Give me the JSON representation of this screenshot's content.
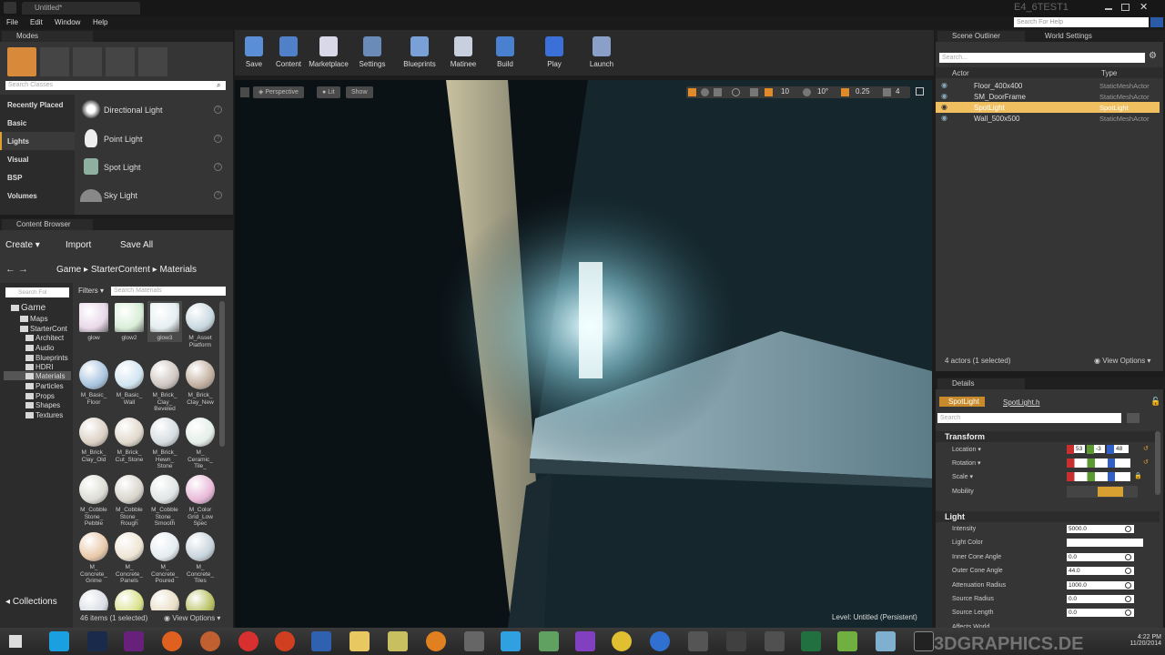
{
  "window": {
    "tab_title": "Untitled*",
    "project_name": "E4_6TEST1",
    "search_help_placeholder": "Search For Help"
  },
  "menu": [
    "File",
    "Edit",
    "Window",
    "Help"
  ],
  "modes": {
    "tab": "Modes",
    "search_placeholder": "Search Classes",
    "categories": [
      "Recently Placed",
      "Basic",
      "Lights",
      "Visual",
      "BSP",
      "Volumes"
    ],
    "items": [
      {
        "label": "Directional Light",
        "icon": "sun-icon"
      },
      {
        "label": "Point Light",
        "icon": "bulb-icon"
      },
      {
        "label": "Spot Light",
        "icon": "spotlight-icon"
      },
      {
        "label": "Sky Light",
        "icon": "dome-icon"
      }
    ]
  },
  "content_browser": {
    "tab": "Content Browser",
    "create": "Create",
    "import": "Import",
    "save_all": "Save All",
    "breadcrumb": [
      "Game",
      "StarterContent",
      "Materials"
    ],
    "folder_search_placeholder": "Search Fol",
    "filters": "Filters",
    "search_placeholder": "Search Materials",
    "tree": [
      {
        "label": "Game",
        "level": 0
      },
      {
        "label": "Maps",
        "level": 1
      },
      {
        "label": "StarterCont",
        "level": 1
      },
      {
        "label": "Architect",
        "level": 2
      },
      {
        "label": "Audio",
        "level": 2
      },
      {
        "label": "Blueprints",
        "level": 2
      },
      {
        "label": "HDRI",
        "level": 2
      },
      {
        "label": "Materials",
        "level": 2,
        "selected": true
      },
      {
        "label": "Particles",
        "level": 2
      },
      {
        "label": "Props",
        "level": 2
      },
      {
        "label": "Shapes",
        "level": 2
      },
      {
        "label": "Textures",
        "level": 2
      }
    ],
    "assets": [
      {
        "label": "glow",
        "color": "#e9d8e9"
      },
      {
        "label": "glow2",
        "color": "#d8eed8"
      },
      {
        "label": "glow3",
        "color": "#e4eef0"
      },
      {
        "label": "M_Asset Platform",
        "color": "#c8d8e0"
      },
      {
        "label": "M_Basic_ Floor",
        "color": "#a8c4e0"
      },
      {
        "label": "M_Basic_ Wall",
        "color": "#d0e4f0"
      },
      {
        "label": "M_Brick_ Clay_ Beveled",
        "color": "#cfc6c0"
      },
      {
        "label": "M_Brick_ Clay_New",
        "color": "#c2b0a0"
      },
      {
        "label": "M_Brick_ Clay_Old",
        "color": "#dcd0c4"
      },
      {
        "label": "M_Brick_ Cut_Stone",
        "color": "#e0d8cc"
      },
      {
        "label": "M_Brick_ Hewn_ Stone",
        "color": "#d4dce0"
      },
      {
        "label": "M_ Ceramic_ Tile_",
        "color": "#e4eee8"
      },
      {
        "label": "M_Cobble Stone_ Pebble",
        "color": "#dcdcd4"
      },
      {
        "label": "M_Cobble Stone_ Rough",
        "color": "#d8d4cc"
      },
      {
        "label": "M_Cobble Stone_ Smooth",
        "color": "#e0e4e4"
      },
      {
        "label": "M_Color Grid_Low Spec",
        "color": "#e8b8d8"
      },
      {
        "label": "M_ Concrete_ Grime",
        "color": "#e8c8a8"
      },
      {
        "label": "M_ Concrete_ Panels",
        "color": "#eee4d4"
      },
      {
        "label": "M_ Concrete_ Poured",
        "color": "#e4ecf0"
      },
      {
        "label": "M_ Concrete_ Tiles",
        "color": "#c8d4dc"
      },
      {
        "label": "",
        "color": "#d8dce4"
      },
      {
        "label": "",
        "color": "#d8e088"
      },
      {
        "label": "",
        "color": "#e8dcc4"
      },
      {
        "label": "",
        "color": "#b8c060"
      }
    ],
    "collections": "Collections",
    "status": "46 items (1 selected)",
    "view_options": "View Options"
  },
  "toolbar": [
    {
      "label": "Save",
      "color": "#5a8fd8"
    },
    {
      "label": "Content",
      "color": "#4f80c8"
    },
    {
      "label": "Marketplace",
      "color": "#d8d8e8"
    },
    {
      "label": "Settings",
      "color": "#6a8ab8"
    },
    {
      "label": "Blueprints",
      "color": "#7aa0d8"
    },
    {
      "label": "Matinee",
      "color": "#c8d0e0"
    },
    {
      "label": "Build",
      "color": "#4a80d0"
    },
    {
      "label": "Play",
      "color": "#3a70d8"
    },
    {
      "label": "Launch",
      "color": "#8aa0c8"
    }
  ],
  "viewport": {
    "perspective": "Perspective",
    "lit": "Lit",
    "show": "Show",
    "grid_snap": "10",
    "rot_snap": "10°",
    "scale_snap": "0.25",
    "camera_speed": "4",
    "level_label": "Level:  Untitled (Persistent)"
  },
  "outliner": {
    "tab": "Scene Outliner",
    "tab2": "World Settings",
    "search_placeholder": "Search...",
    "col_actor": "Actor",
    "col_type": "Type",
    "rows": [
      {
        "name": "Floor_400x400",
        "type": "StaticMeshActor",
        "selected": false
      },
      {
        "name": "SM_DoorFrame",
        "type": "StaticMeshActor",
        "selected": false
      },
      {
        "name": "SpotLight",
        "type": "SpotLight",
        "selected": true
      },
      {
        "name": "Wall_500x500",
        "type": "StaticMeshActor",
        "selected": false
      }
    ],
    "status": "4 actors (1 selected)",
    "view_options": "View Options"
  },
  "details": {
    "tab": "Details",
    "object_name": "SpotLight",
    "class_link": "SpotLight.h",
    "search_placeholder": "Search",
    "transform_header": "Transform",
    "location_label": "Location",
    "rotation_label": "Rotation",
    "scale_label": "Scale",
    "mobility_label": "Mobility",
    "location": [
      "53",
      "-3",
      "48"
    ],
    "light_header": "Light",
    "props": [
      {
        "label": "Intensity",
        "value": "5000.0"
      },
      {
        "label": "Light Color",
        "value": ""
      },
      {
        "label": "Inner Cone Angle",
        "value": "0.0"
      },
      {
        "label": "Outer Cone Angle",
        "value": "44.0"
      },
      {
        "label": "Attenuation Radius",
        "value": "1000.0"
      },
      {
        "label": "Source Radius",
        "value": "0.0"
      },
      {
        "label": "Source Length",
        "value": "0.0"
      },
      {
        "label": "Affects World",
        "value": ""
      }
    ]
  },
  "taskbar": {
    "time": "4:22 PM",
    "date": "11/20/2014",
    "watermark": "3DGRAPHICS.DE"
  }
}
